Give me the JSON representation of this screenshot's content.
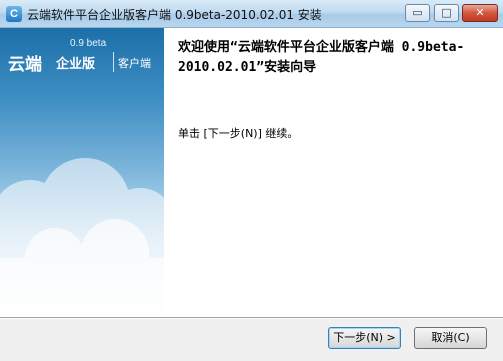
{
  "window": {
    "title": "云端软件平台企业版客户端 0.9beta-2010.02.01 安装",
    "icon_glyph": "C",
    "minimize_glyph": "▭",
    "maximize_glyph": "□",
    "close_glyph": "✕"
  },
  "banner": {
    "version": "0.9 beta",
    "brand": "云端",
    "edition": "企业版",
    "client": "客户端"
  },
  "content": {
    "heading": "欢迎使用“云端软件平台企业版客户端 0.9beta-2010.02.01”安装向导",
    "instruction": "单击 [下一步(N)] 继续。"
  },
  "buttons": {
    "next": "下一步(N) >",
    "cancel": "取消(C)"
  }
}
